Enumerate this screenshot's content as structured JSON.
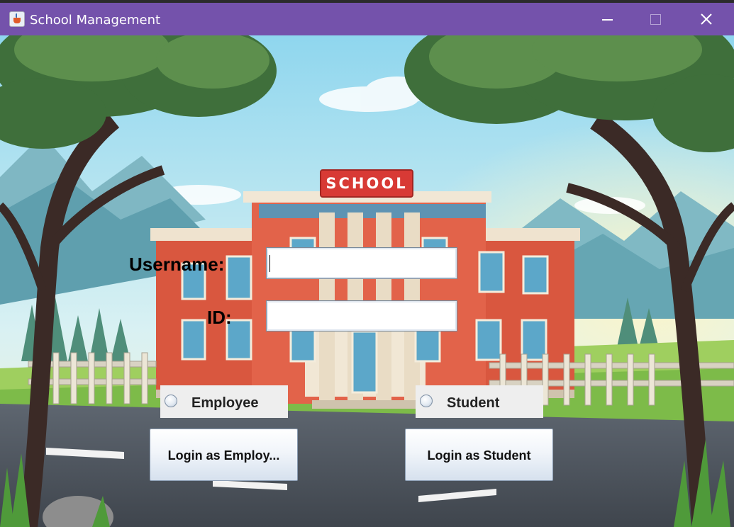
{
  "window": {
    "title": "School Management",
    "icon": "java-cup-icon",
    "controls": [
      "minimize-icon",
      "maximize-icon",
      "close-icon"
    ],
    "accent": "#7452ab"
  },
  "background": {
    "sign_text": "SCHOOL"
  },
  "form": {
    "username_label": "Username:",
    "username_value": "",
    "id_label": "ID:",
    "id_value": ""
  },
  "roles": {
    "employee_label": "Employee",
    "employee_selected": false,
    "student_label": "Student",
    "student_selected": false
  },
  "buttons": {
    "login_employee": "Login as Employ...",
    "login_student": "Login as Student"
  }
}
